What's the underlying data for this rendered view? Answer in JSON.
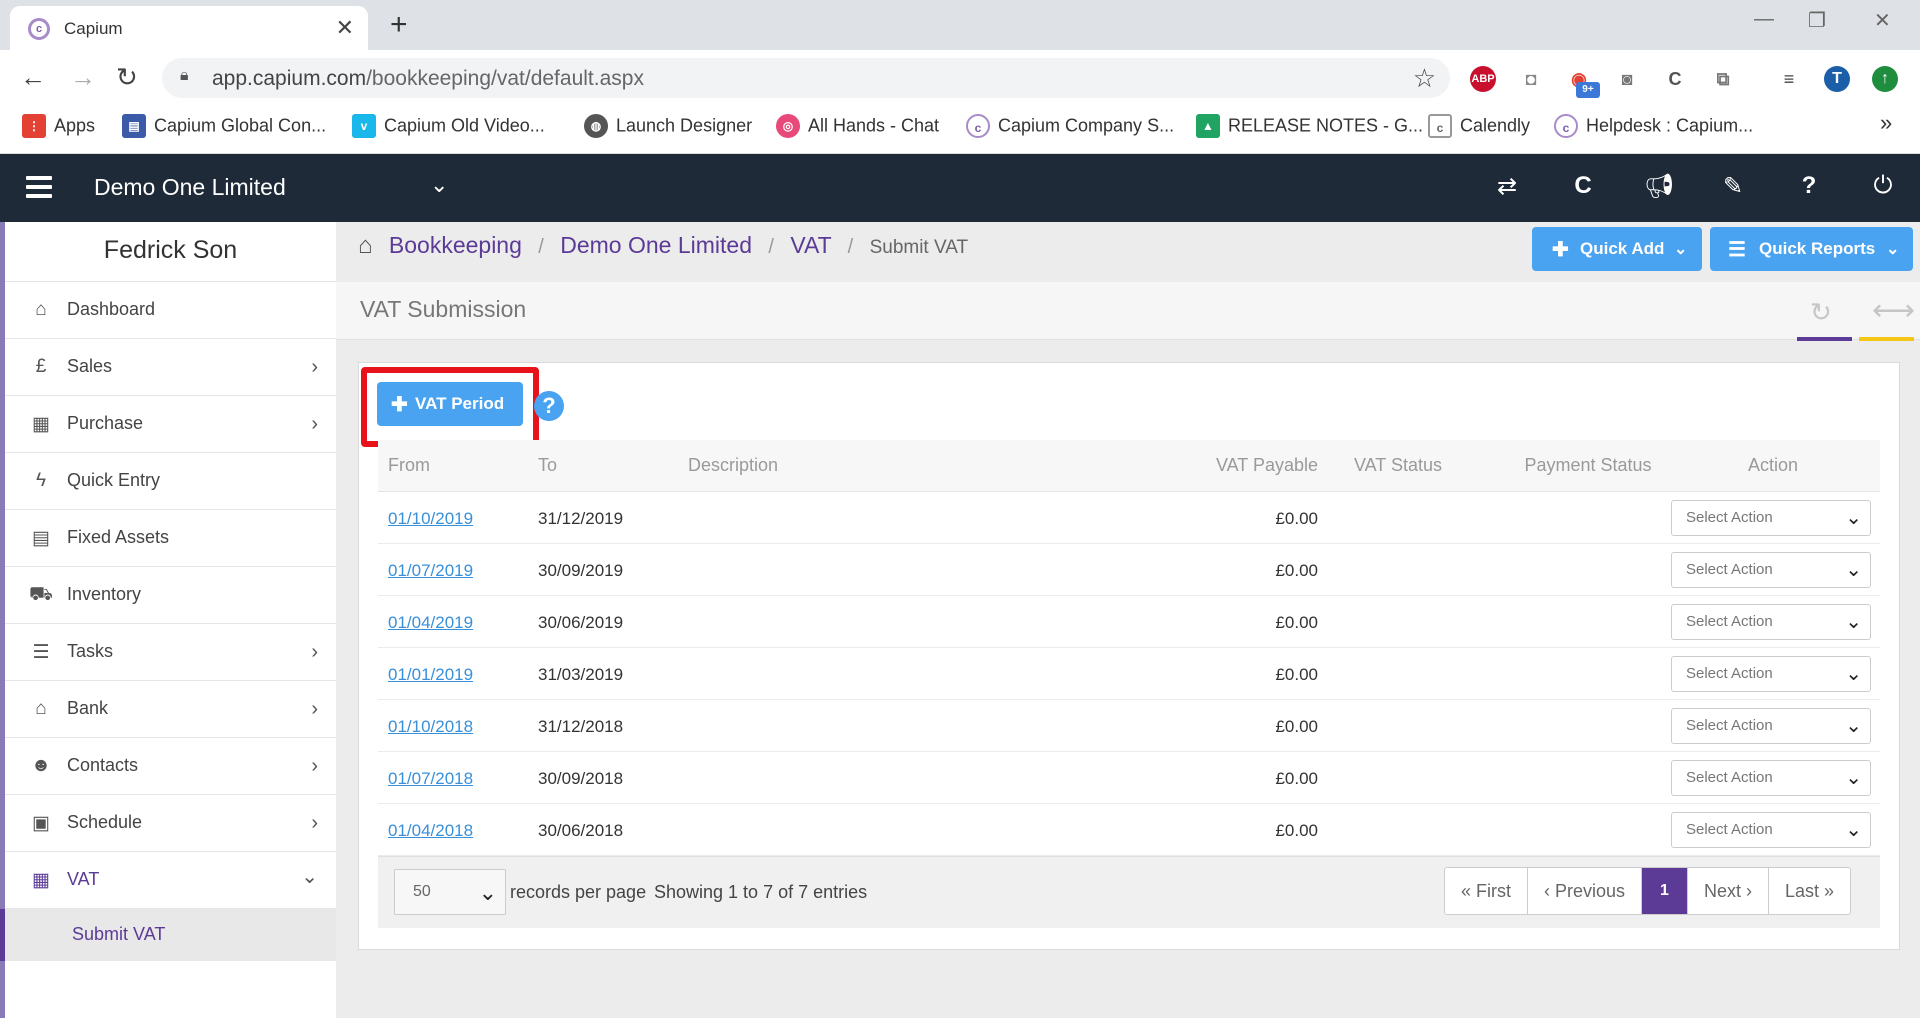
{
  "browser": {
    "tab_title": "Capium",
    "url_domain": "app.capium.com",
    "url_path": "/bookkeeping/vat/default.aspx",
    "bookmarks": [
      {
        "label": "Apps",
        "color": "#e34133"
      },
      {
        "label": "Capium Global Con...",
        "color": "#3b5aa8"
      },
      {
        "label": "Capium Old Video...",
        "color": "#1ab7ea"
      },
      {
        "label": "Launch Designer",
        "color": "#555555"
      },
      {
        "label": "All Hands - Chat",
        "color": "#e6497a"
      },
      {
        "label": "Capium Company S...",
        "color": "#a88bc9"
      },
      {
        "label": "RELEASE NOTES - G...",
        "color": "#1fa463"
      },
      {
        "label": "Calendly",
        "color": "#888888"
      },
      {
        "label": "Helpdesk : Capium...",
        "color": "#a88bc9"
      }
    ],
    "extensions": [
      {
        "name": "adblock-icon",
        "label": "ABP",
        "color": "#c8102e"
      },
      {
        "name": "notification-badge",
        "label": "9+",
        "color": "#3c78d8"
      }
    ],
    "profile_initial": "T"
  },
  "header": {
    "company": "Demo One Limited"
  },
  "sidebar": {
    "user": "Fedrick Son",
    "items": [
      {
        "label": "Dashboard",
        "icon": "home-icon",
        "glyph": "⌂",
        "chevron": ""
      },
      {
        "label": "Sales",
        "icon": "pound-icon",
        "glyph": "£",
        "chevron": "›"
      },
      {
        "label": "Purchase",
        "icon": "qrcode-icon",
        "glyph": "▦",
        "chevron": "›"
      },
      {
        "label": "Quick Entry",
        "icon": "bolt-icon",
        "glyph": "ϟ",
        "chevron": ""
      },
      {
        "label": "Fixed Assets",
        "icon": "building-icon",
        "glyph": "▤",
        "chevron": ""
      },
      {
        "label": "Inventory",
        "icon": "truck-icon",
        "glyph": "⛟",
        "chevron": ""
      },
      {
        "label": "Tasks",
        "icon": "tasks-icon",
        "glyph": "☰",
        "chevron": "›"
      },
      {
        "label": "Bank",
        "icon": "bank-icon",
        "glyph": "⌂",
        "chevron": "›"
      },
      {
        "label": "Contacts",
        "icon": "users-icon",
        "glyph": "☻",
        "chevron": "›"
      },
      {
        "label": "Schedule",
        "icon": "calendar-icon",
        "glyph": "▣",
        "chevron": "›"
      },
      {
        "label": "VAT",
        "icon": "calculator-icon",
        "glyph": "▦",
        "chevron": "⌄"
      }
    ],
    "sub_item": "Submit VAT"
  },
  "breadcrumb": {
    "items": [
      "Bookkeeping",
      "Demo One Limited",
      "VAT"
    ],
    "current": "Submit VAT"
  },
  "buttons": {
    "quick_add": "Quick Add",
    "quick_reports": "Quick Reports",
    "vat_period": "VAT Period"
  },
  "panel": {
    "title": "VAT Submission"
  },
  "table": {
    "columns": [
      "From",
      "To",
      "Description",
      "VAT Payable",
      "VAT Status",
      "Payment Status",
      "Action"
    ],
    "action_placeholder": "Select Action",
    "rows": [
      {
        "from": "01/10/2019",
        "to": "31/12/2019",
        "description": "",
        "payable": "£0.00",
        "status": "",
        "payment": ""
      },
      {
        "from": "01/07/2019",
        "to": "30/09/2019",
        "description": "",
        "payable": "£0.00",
        "status": "",
        "payment": ""
      },
      {
        "from": "01/04/2019",
        "to": "30/06/2019",
        "description": "",
        "payable": "£0.00",
        "status": "",
        "payment": ""
      },
      {
        "from": "01/01/2019",
        "to": "31/03/2019",
        "description": "",
        "payable": "£0.00",
        "status": "",
        "payment": ""
      },
      {
        "from": "01/10/2018",
        "to": "31/12/2018",
        "description": "",
        "payable": "£0.00",
        "status": "",
        "payment": ""
      },
      {
        "from": "01/07/2018",
        "to": "30/09/2018",
        "description": "",
        "payable": "£0.00",
        "status": "",
        "payment": ""
      },
      {
        "from": "01/04/2018",
        "to": "30/06/2018",
        "description": "",
        "payable": "£0.00",
        "status": "",
        "payment": ""
      }
    ]
  },
  "footer": {
    "page_size": "50",
    "records_label": "records per page",
    "showing": "Showing 1 to 7 of 7 entries",
    "pager": {
      "first": "« First",
      "previous": "‹ Previous",
      "current": "1",
      "next": "Next ›",
      "last": "Last »"
    }
  },
  "colors": {
    "brand_purple": "#5c3b96",
    "button_blue": "#4aa3f0",
    "header_dark": "#1f2a38",
    "highlight_red": "#e8131a"
  }
}
